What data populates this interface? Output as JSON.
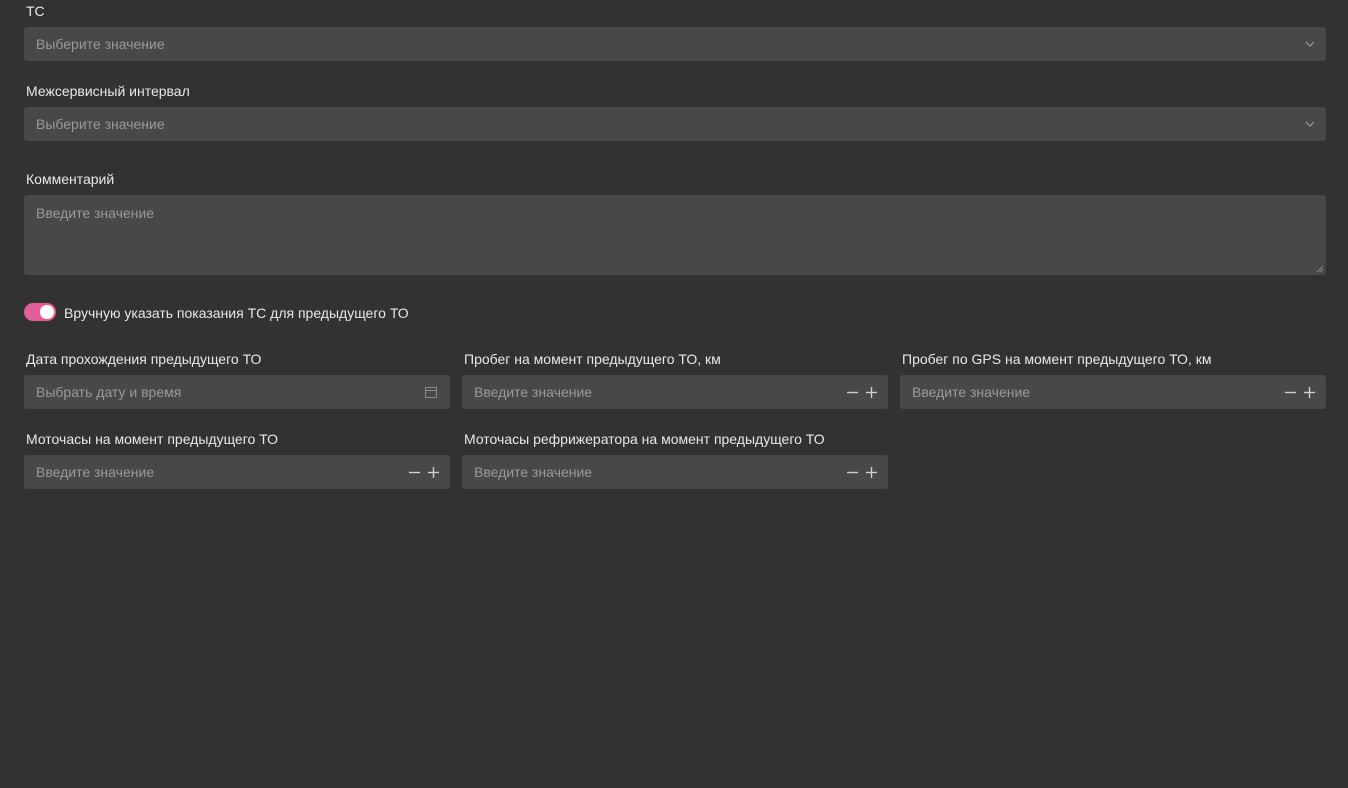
{
  "form": {
    "vehicle": {
      "label": "ТС",
      "placeholder": "Выберите значение"
    },
    "service_interval": {
      "label": "Межсервисный интервал",
      "placeholder": "Выберите значение"
    },
    "comment": {
      "label": "Комментарий",
      "placeholder": "Введите значение"
    },
    "manual_toggle": {
      "label": "Вручную указать показания ТС для предыдущего ТО",
      "checked": true
    },
    "prev_date": {
      "label": "Дата прохождения предыдущего ТО",
      "placeholder": "Выбрать дату и время"
    },
    "prev_mileage": {
      "label": "Пробег на момент предыдущего ТО, км",
      "placeholder": "Введите значение"
    },
    "prev_gps_mileage": {
      "label": "Пробег по GPS на момент предыдущего ТО, км",
      "placeholder": "Введите значение"
    },
    "prev_engine_hours": {
      "label": "Моточасы на момент предыдущего ТО",
      "placeholder": "Введите значение"
    },
    "prev_fridge_hours": {
      "label": "Моточасы рефрижератора на момент предыдущего ТО",
      "placeholder": "Введите значение"
    }
  },
  "icons": {
    "dropdown": "chevron-down-icon",
    "calendar": "calendar-icon",
    "decrement": "minus-icon",
    "increment": "plus-icon"
  },
  "colors": {
    "background": "#323232",
    "field": "#484848",
    "accent": "#e35d97"
  }
}
